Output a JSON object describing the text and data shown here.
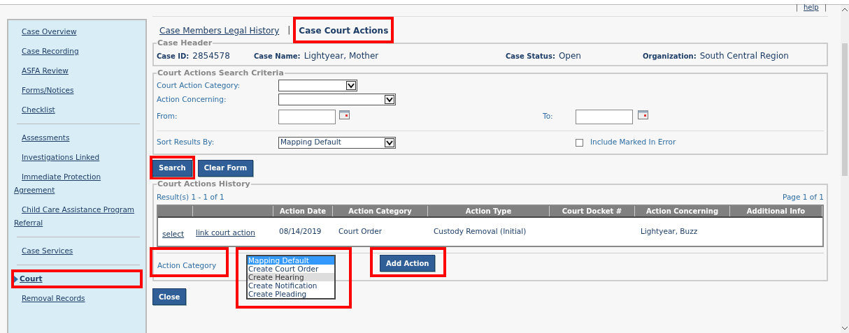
{
  "top_links": [
    {
      "before": "|",
      "label": "help",
      "after": "|"
    }
  ],
  "sidebar": {
    "groups": [
      [
        {
          "label": "Case Overview",
          "selected": false,
          "highlighted": false
        },
        {
          "label": "Case Recording",
          "selected": false,
          "highlighted": false
        },
        {
          "label": "ASFA Review",
          "selected": false,
          "highlighted": false
        },
        {
          "label": "Forms/Notices",
          "selected": false,
          "highlighted": false
        },
        {
          "label": "Checklist",
          "selected": false,
          "highlighted": false
        }
      ],
      [
        {
          "label": "Assessments",
          "selected": false,
          "highlighted": false
        },
        {
          "label": "Investigations Linked",
          "selected": false,
          "highlighted": false
        },
        {
          "label": "Immediate Protection Agreement",
          "selected": false,
          "highlighted": false
        },
        {
          "label": "Child Care Assistance Program Referral",
          "selected": false,
          "highlighted": false
        }
      ],
      [
        {
          "label": "Case Services",
          "selected": false,
          "highlighted": false
        }
      ],
      [
        {
          "label": "Court",
          "selected": true,
          "highlighted": true
        },
        {
          "label": "Removal Records",
          "selected": false,
          "highlighted": false
        }
      ]
    ]
  },
  "tab_separator": "|",
  "tabs": [
    {
      "label": "Case Members Legal History",
      "selected": false,
      "highlighted": false
    },
    {
      "label": "Case Court Actions",
      "selected": true,
      "highlighted": true
    }
  ],
  "case_header": {
    "legend": "Case Header",
    "fields": [
      {
        "label": "Case ID:",
        "value": "2854578"
      },
      {
        "label": "Case Name:",
        "value": "Lightyear, Mother"
      },
      {
        "label": "Case Status:",
        "value": "Open"
      },
      {
        "label": "Organization:",
        "value": "South Central Region"
      }
    ]
  },
  "search_criteria": {
    "legend": "Court Actions Search Criteria",
    "court_action_category": {
      "label": "Court Action Category:"
    },
    "action_concerning": {
      "label": "Action Concerning:"
    },
    "from": {
      "label": "From:"
    },
    "to": {
      "label": "To:"
    },
    "sort_by": {
      "label": "Sort Results By:",
      "value": "Mapping Default"
    },
    "include_marked_in_error": {
      "label": "Include Marked In Error",
      "checked": false
    }
  },
  "buttons": [
    {
      "label": "Search",
      "highlighted": true
    },
    {
      "label": "Clear Form",
      "highlighted": false
    }
  ],
  "history": {
    "legend": "Court Actions History",
    "results": "Result(s) 1 - 1 of 1",
    "page": "Page 1 of 1",
    "columns": [
      "Action Date",
      "Action Category",
      "Action Type",
      "Court Docket #",
      "Action Concerning",
      "Additional Info"
    ],
    "rows": [
      {
        "select": "select",
        "link": "link court action",
        "cells": [
          "08/14/2019",
          "Court Order",
          "Custody Removal (Initial)",
          null,
          "Lightyear, Buzz",
          null
        ]
      }
    ]
  },
  "action_category": {
    "label": "Action Category",
    "label_highlighted": true,
    "listbox_highlighted": true,
    "options": [
      {
        "label": "Mapping Default",
        "selected": true,
        "hovered": false
      },
      {
        "label": "Create Court Order",
        "selected": false,
        "hovered": false
      },
      {
        "label": "Create Hearing",
        "selected": false,
        "hovered": true
      },
      {
        "label": "Create Notification",
        "selected": false,
        "hovered": false
      },
      {
        "label": "Create Pleading",
        "selected": false,
        "hovered": false
      }
    ]
  },
  "add_action": {
    "label": "Add Action",
    "highlighted": true
  },
  "close": {
    "label": "Close",
    "highlighted": false
  }
}
